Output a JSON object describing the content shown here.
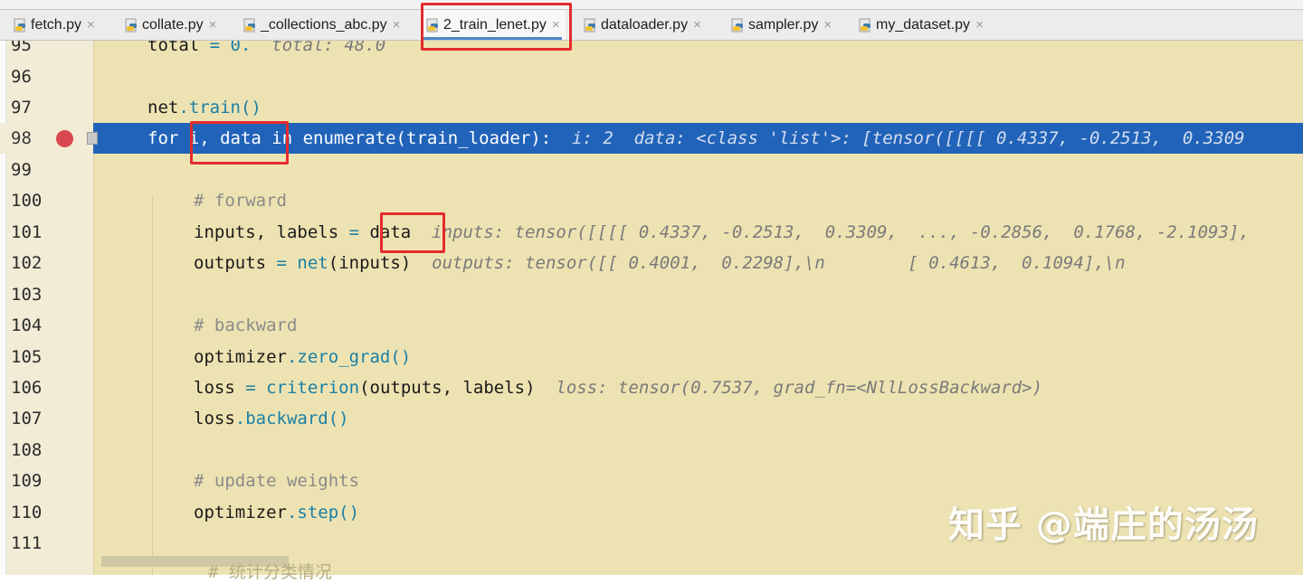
{
  "tabs": [
    {
      "label": "fetch.py",
      "active": false
    },
    {
      "label": "collate.py",
      "active": false
    },
    {
      "label": "_collections_abc.py",
      "active": false
    },
    {
      "label": "2_train_lenet.py",
      "active": true
    },
    {
      "label": "dataloader.py",
      "active": false
    },
    {
      "label": "sampler.py",
      "active": false
    },
    {
      "label": "my_dataset.py",
      "active": false
    }
  ],
  "tab_close_glyph": "×",
  "code": {
    "l95": {
      "num": "95",
      "a": "total ",
      "op": "=",
      "num0": " 0.",
      "hint": "  total: 48.0"
    },
    "l96": {
      "num": "96"
    },
    "l97": {
      "num": "97",
      "a": "net",
      "dot": ".",
      "fn": "train",
      "paren": "()"
    },
    "l98": {
      "num": "98",
      "kw1": "for",
      "vars": " i, data ",
      "kw2": "in",
      "rest": " enumerate(train_loader):",
      "hint": "  i: 2  data: <class 'list'>: [tensor([[[[ 0.4337, -0.2513,  0.3309"
    },
    "l99": {
      "num": "99"
    },
    "l100": {
      "num": "100",
      "comment": "# forward"
    },
    "l101": {
      "num": "101",
      "a": "inputs, labels ",
      "op": "=",
      "b": " data",
      "hint": "  inputs: tensor([[[[ 0.4337, -0.2513,  0.3309,  ..., -0.2856,  0.1768, -2.1093],"
    },
    "l102": {
      "num": "102",
      "a": "outputs ",
      "op": "=",
      "sp": " ",
      "fn": "net",
      "b": "(inputs)",
      "hint": "  outputs: tensor([[ 0.4001,  0.2298],\\n        [ 0.4613,  0.1094],\\n"
    },
    "l103": {
      "num": "103"
    },
    "l104": {
      "num": "104",
      "comment": "# backward"
    },
    "l105": {
      "num": "105",
      "a": "optimizer",
      "dot": ".",
      "fn": "zero_grad",
      "paren": "()"
    },
    "l106": {
      "num": "106",
      "a": "loss ",
      "op": "=",
      "sp": " ",
      "fn": "criterion",
      "b": "(outputs, labels)",
      "hint": "  loss: tensor(0.7537, grad_fn=<NllLossBackward>)"
    },
    "l107": {
      "num": "107",
      "a": "loss",
      "dot": ".",
      "fn": "backward",
      "paren": "()"
    },
    "l108": {
      "num": "108"
    },
    "l109": {
      "num": "109",
      "comment": "# update weights"
    },
    "l110": {
      "num": "110",
      "a": "optimizer",
      "dot": ".",
      "fn": "step",
      "paren": "()"
    },
    "l111": {
      "num": "111"
    },
    "l112": {
      "comment": "# 统计分类情况"
    }
  },
  "watermark": "知乎 @端庄的汤汤",
  "colors": {
    "editor_bg": "#ede3b2",
    "current_line": "#2163b9",
    "breakpoint": "#d9484f",
    "highlight_box": "#e32b2b",
    "active_tab_underline": "#4a88c7"
  },
  "icons": {
    "file_icon": "python-file-icon",
    "close_icon": "close-icon",
    "breakpoint": "breakpoint-icon"
  }
}
